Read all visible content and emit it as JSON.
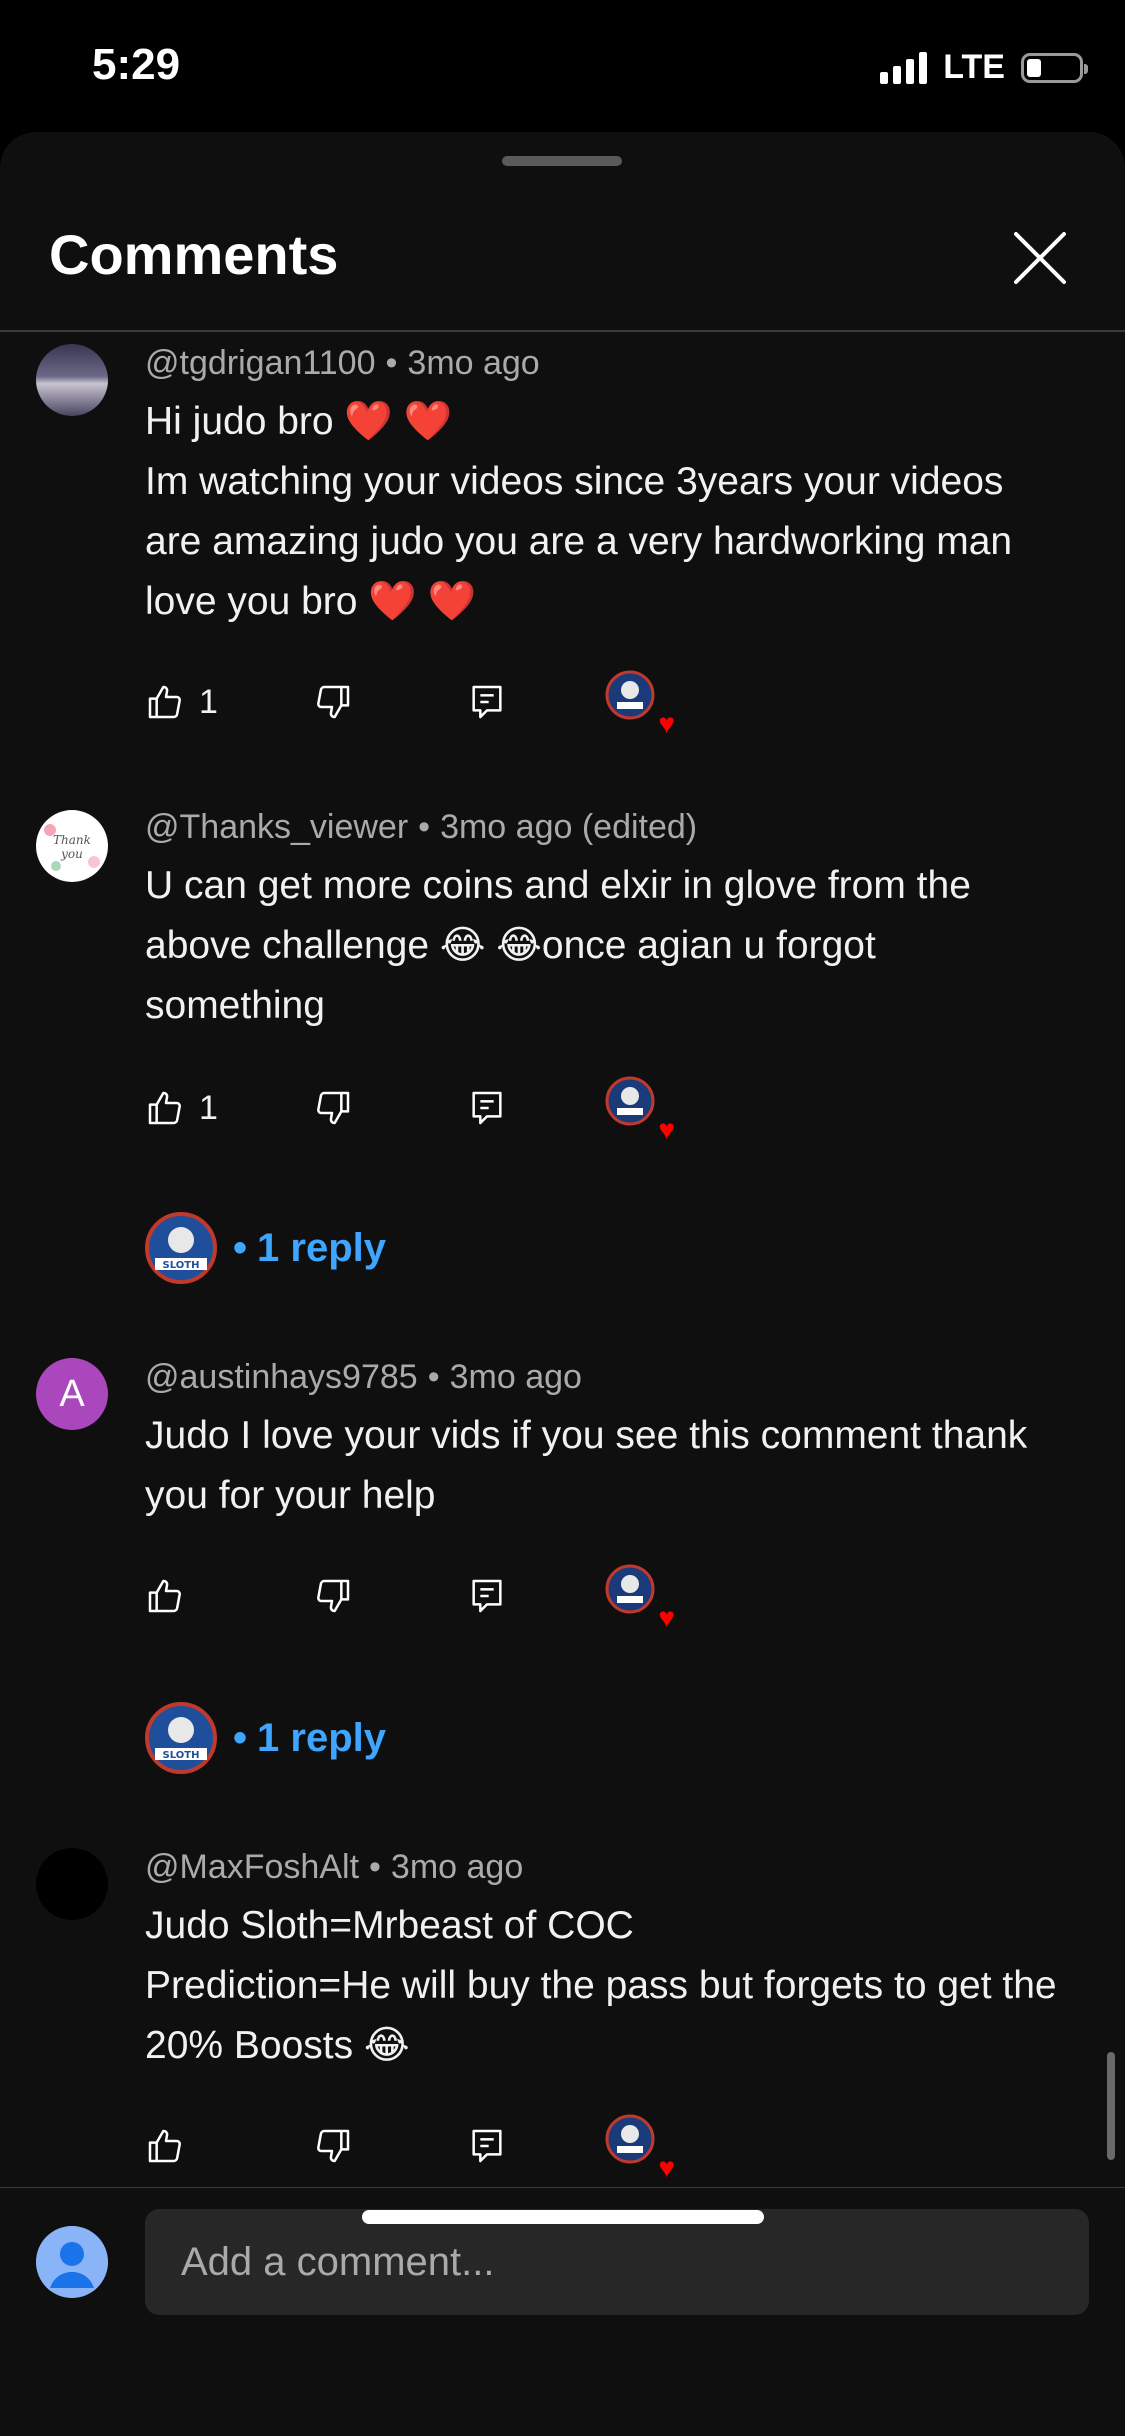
{
  "status_bar": {
    "time": "5:29",
    "network": "LTE"
  },
  "sheet": {
    "title": "Comments"
  },
  "comments": [
    {
      "author": "@tgdrigan1100",
      "age": "3mo ago",
      "lines": [
        "Hi judo bro ❤️ ❤️",
        "Im watching your videos since  3years your videos are amazing judo you are a very hardworking man love you bro ❤️ ❤️"
      ],
      "likes": "1",
      "avatar_icon": "landscape-avatar-icon"
    },
    {
      "author": "@Thanks_viewer",
      "age": "3mo ago (edited)",
      "lines": [
        "U can get more coins and elxir in glove from the above challenge 😂 😂once agian u forgot something"
      ],
      "likes": "1",
      "avatar_icon": "thank-you-avatar-icon",
      "reply_label": "1 reply"
    },
    {
      "author": "@austinhays9785",
      "age": "3mo ago",
      "lines": [
        "Judo I love your vids if you see this comment thank you for your help"
      ],
      "likes": "",
      "avatar_letter": "A",
      "avatar_color": "#ab47bc",
      "reply_label": "1 reply"
    },
    {
      "author": "@MaxFoshAlt",
      "age": "3mo ago",
      "lines": [
        "Judo Sloth=Mrbeast of COC",
        "Prediction=He will buy the pass but forgets to get the 20% Boosts 😂"
      ],
      "likes": "",
      "avatar_icon": "black-avatar-icon"
    }
  ],
  "reply_prefix": "•",
  "creator_badge_text": "SLOTH",
  "add_comment": {
    "placeholder": "Add a comment..."
  },
  "colors": {
    "link": "#3ea6ff",
    "background": "#0f0f0f",
    "heart": "#ff0000"
  }
}
